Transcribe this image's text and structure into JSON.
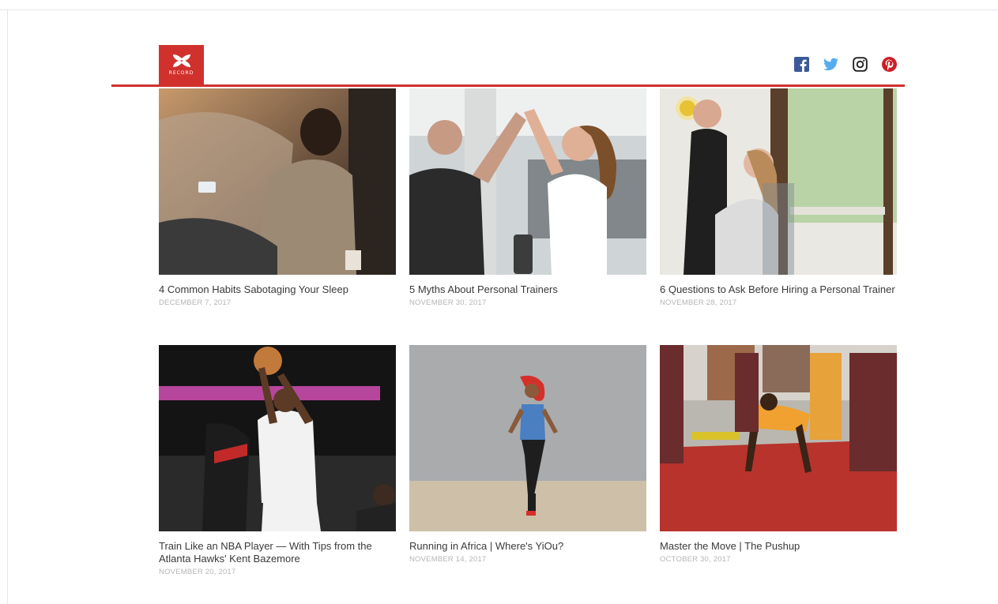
{
  "brand": {
    "logo_text": "RECORD",
    "accent_color": "#d0312d"
  },
  "social": [
    {
      "name": "facebook",
      "color": "#3b5998"
    },
    {
      "name": "twitter",
      "color": "#55acee"
    },
    {
      "name": "instagram",
      "color": "#222222"
    },
    {
      "name": "pinterest",
      "color": "#cb2027"
    }
  ],
  "articles": [
    {
      "title": "4 Common Habits Sabotaging Your Sleep",
      "date": "DECEMBER 7, 2017"
    },
    {
      "title": "5 Myths About Personal Trainers",
      "date": "NOVEMBER 30, 2017"
    },
    {
      "title": "6 Questions to Ask Before Hiring a Personal Trainer",
      "date": "NOVEMBER 28, 2017"
    },
    {
      "title": "Train Like an NBA Player — With Tips from the Atlanta Hawks' Kent Bazemore",
      "date": "NOVEMBER 20, 2017"
    },
    {
      "title": "Running in Africa | Where's YiOu?",
      "date": "NOVEMBER 14, 2017"
    },
    {
      "title": "Master the Move | The Pushup",
      "date": "OCTOBER 30, 2017"
    }
  ]
}
